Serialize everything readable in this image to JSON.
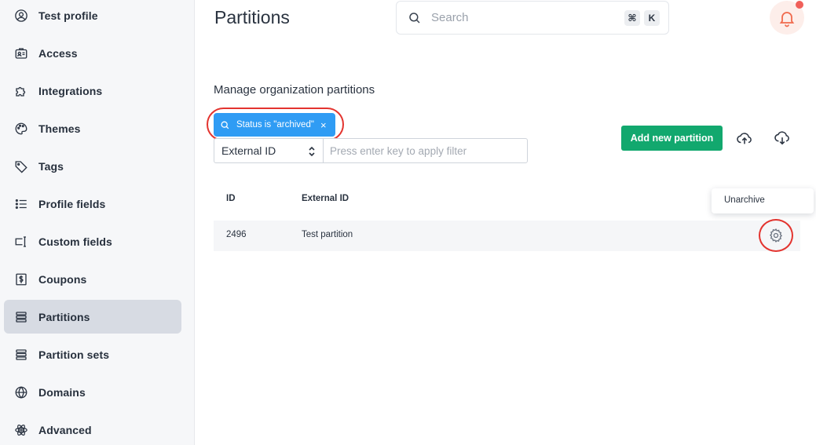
{
  "sidebar": {
    "items": [
      {
        "label": "Test profile",
        "icon": "user-circle-icon"
      },
      {
        "label": "Access",
        "icon": "id-card-icon"
      },
      {
        "label": "Integrations",
        "icon": "puzzle-icon"
      },
      {
        "label": "Themes",
        "icon": "palette-icon"
      },
      {
        "label": "Tags",
        "icon": "tag-icon"
      },
      {
        "label": "Profile fields",
        "icon": "list-icon"
      },
      {
        "label": "Custom fields",
        "icon": "text-cursor-icon"
      },
      {
        "label": "Coupons",
        "icon": "dollar-icon"
      },
      {
        "label": "Partitions",
        "icon": "stack-icon",
        "active": true
      },
      {
        "label": "Partition sets",
        "icon": "stack-icon"
      },
      {
        "label": "Domains",
        "icon": "globe-icon"
      },
      {
        "label": "Advanced",
        "icon": "atom-icon"
      }
    ]
  },
  "header": {
    "title": "Partitions",
    "search_placeholder": "Search",
    "shortcut_mod": "⌘",
    "shortcut_key": "K"
  },
  "main": {
    "subtitle": "Manage organization partitions",
    "filter_chip": "Status is \"archived\"",
    "filter_chip_close": "×",
    "filter_field": "External ID",
    "filter_placeholder": "Press enter key to apply filter",
    "add_button": "Add new partition",
    "table": {
      "columns": [
        "ID",
        "External ID"
      ],
      "rows": [
        {
          "id": "2496",
          "external_id": "Test partition"
        }
      ]
    },
    "row_menu": {
      "items": [
        "Unarchive"
      ]
    }
  },
  "colors": {
    "primary_green": "#12a86e",
    "chip_blue": "#2f9cf4",
    "highlight_red": "#e3342f",
    "bell_accent": "#f06a4d"
  }
}
